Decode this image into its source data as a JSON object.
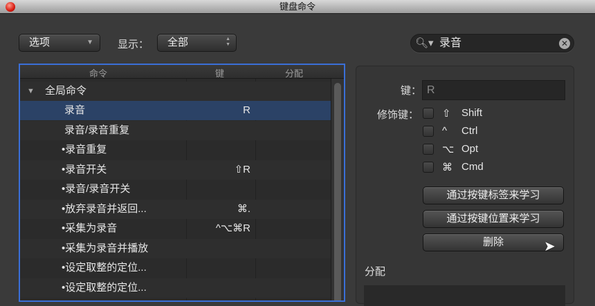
{
  "window": {
    "title": "键盘命令"
  },
  "toolbar": {
    "options_label": "选项",
    "show_label": "显示：",
    "show_value": "全部"
  },
  "search": {
    "value": "录音"
  },
  "table": {
    "headers": {
      "command": "命令",
      "key": "键",
      "assignment": "分配"
    },
    "group": "全局命令",
    "rows": [
      {
        "command": "录音",
        "key": "R",
        "selected": true
      },
      {
        "command": "录音/录音重复",
        "key": ""
      },
      {
        "command": "•录音重复",
        "key": ""
      },
      {
        "command": "•录音开关",
        "key": "⇧R"
      },
      {
        "command": "•录音/录音开关",
        "key": ""
      },
      {
        "command": "•放弃录音并返回...",
        "key": "⌘."
      },
      {
        "command": "•采集为录音",
        "key": "^⌥⌘R"
      },
      {
        "command": "•采集为录音并播放",
        "key": ""
      },
      {
        "command": "•设定取整的定位...",
        "key": ""
      },
      {
        "command": "•设定取整的定位...",
        "key": ""
      }
    ]
  },
  "panel": {
    "key_label": "键：",
    "key_value": "R",
    "modifier_label": "修饰键：",
    "modifiers": [
      {
        "symbol": "⇧",
        "name": "Shift"
      },
      {
        "symbol": "^",
        "name": "Ctrl"
      },
      {
        "symbol": "⌥",
        "name": "Opt"
      },
      {
        "symbol": "⌘",
        "name": "Cmd"
      }
    ],
    "learn_by_label": "通过按键标签来学习",
    "learn_by_position": "通过按键位置来学习",
    "delete": "删除",
    "assignment_label": "分配"
  }
}
